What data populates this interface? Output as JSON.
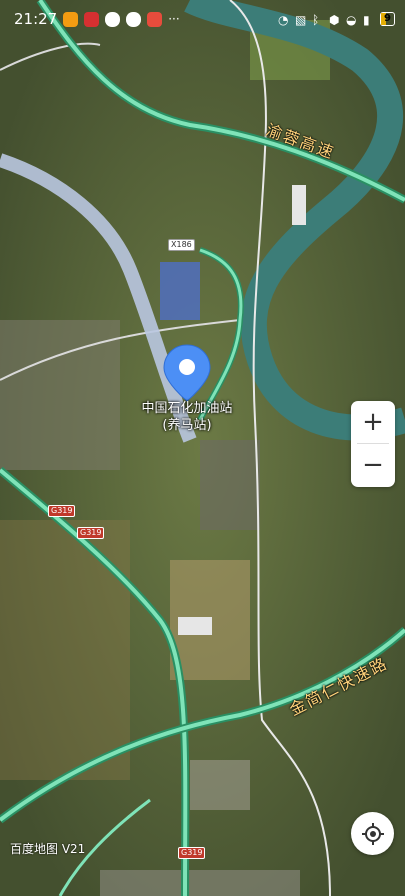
{
  "status": {
    "time": "21:27",
    "battery": "9",
    "more": "···"
  },
  "map": {
    "poi": {
      "name": "中国石化加油站",
      "sub": "(养马站)"
    },
    "road_labels": [
      "渝蓉高速",
      "金简仁快速路"
    ],
    "shields": [
      "X186",
      "G319",
      "G319",
      "G319"
    ],
    "brand": "百度地图 V21",
    "colors": {
      "highway": "#7fe3b8",
      "water": "#3c7d78",
      "pin": "#4c8ff5"
    }
  },
  "controls": {
    "zoom_in": "+",
    "zoom_out": "−"
  }
}
